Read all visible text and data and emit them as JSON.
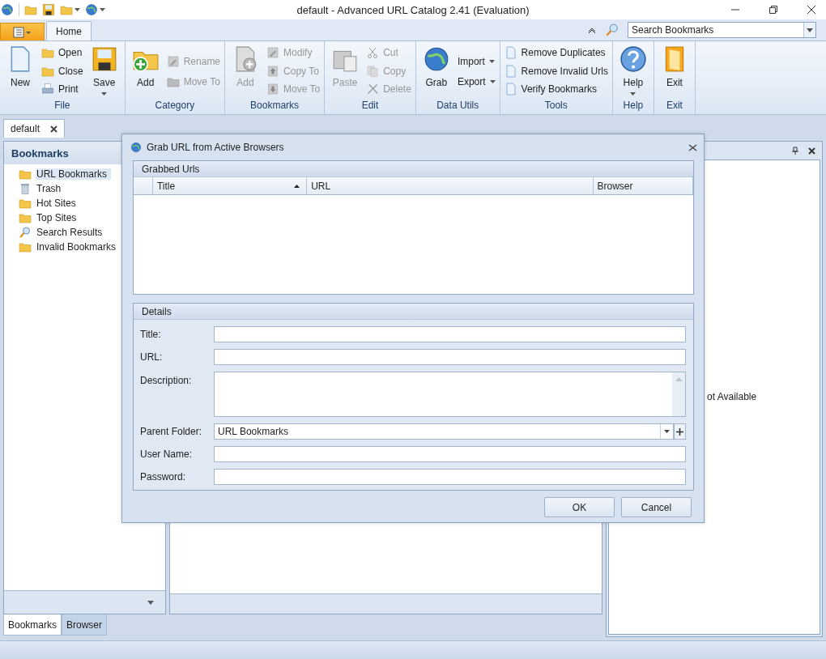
{
  "window": {
    "title": "default - Advanced URL Catalog 2.41 (Evaluation)"
  },
  "ribbon": {
    "tabs": [
      {
        "label": "Home",
        "selected": true
      }
    ],
    "search": {
      "value": "Search Bookmarks"
    },
    "groups": [
      {
        "label": "File",
        "items": [
          {
            "kind": "large",
            "label": "New",
            "disabled": false,
            "dropdown": false
          },
          {
            "kind": "small",
            "label": "Open",
            "disabled": false,
            "dropdown": false
          },
          {
            "kind": "small",
            "label": "Close",
            "disabled": false,
            "dropdown": false
          },
          {
            "kind": "small",
            "label": "Print",
            "disabled": false,
            "dropdown": false
          },
          {
            "kind": "large",
            "label": "Save",
            "disabled": false,
            "dropdown": true
          }
        ]
      },
      {
        "label": "Category",
        "items": [
          {
            "kind": "large",
            "label": "Add",
            "disabled": false,
            "dropdown": false
          },
          {
            "kind": "small",
            "label": "Rename",
            "disabled": true,
            "dropdown": false
          },
          {
            "kind": "small",
            "label": "Move To",
            "disabled": true,
            "dropdown": false
          }
        ]
      },
      {
        "label": "Bookmarks",
        "items": [
          {
            "kind": "large",
            "label": "Add",
            "disabled": true,
            "dropdown": false
          },
          {
            "kind": "small",
            "label": "Modify",
            "disabled": true,
            "dropdown": false
          },
          {
            "kind": "small",
            "label": "Copy To",
            "disabled": true,
            "dropdown": false
          },
          {
            "kind": "small",
            "label": "Move To",
            "disabled": true,
            "dropdown": false
          }
        ]
      },
      {
        "label": "Edit",
        "items": [
          {
            "kind": "large",
            "label": "Paste",
            "disabled": true,
            "dropdown": false
          },
          {
            "kind": "small",
            "label": "Cut",
            "disabled": true,
            "dropdown": false
          },
          {
            "kind": "small",
            "label": "Copy",
            "disabled": true,
            "dropdown": false
          },
          {
            "kind": "small",
            "label": "Delete",
            "disabled": true,
            "dropdown": false
          }
        ]
      },
      {
        "label": "Data Utils",
        "items": [
          {
            "kind": "large",
            "label": "Grab",
            "disabled": false,
            "dropdown": false
          },
          {
            "kind": "small",
            "label": "Import",
            "disabled": false,
            "dropdown": true
          },
          {
            "kind": "small",
            "label": "Export",
            "disabled": false,
            "dropdown": true
          }
        ]
      },
      {
        "label": "Tools",
        "items": [
          {
            "kind": "small",
            "label": "Remove Duplicates",
            "disabled": false,
            "dropdown": false
          },
          {
            "kind": "small",
            "label": "Remove Invalid Urls",
            "disabled": false,
            "dropdown": false
          },
          {
            "kind": "small",
            "label": "Verify Bookmarks",
            "disabled": false,
            "dropdown": false
          }
        ]
      },
      {
        "label": "Help",
        "items": [
          {
            "kind": "large",
            "label": "Help",
            "disabled": false,
            "dropdown": true
          }
        ]
      },
      {
        "label": "Exit",
        "items": [
          {
            "kind": "large",
            "label": "Exit",
            "disabled": false,
            "dropdown": false
          }
        ]
      }
    ]
  },
  "document_tabs": [
    {
      "label": "default"
    }
  ],
  "bookmarks_panel": {
    "title": "Bookmarks",
    "items": [
      {
        "label": "URL Bookmarks",
        "selected": true
      },
      {
        "label": "Trash",
        "selected": false
      },
      {
        "label": "Hot Sites",
        "selected": false
      },
      {
        "label": "Top Sites",
        "selected": false
      },
      {
        "label": "Search Results",
        "selected": false
      },
      {
        "label": "Invalid Bookmarks",
        "selected": false
      }
    ]
  },
  "bottom_tabs": [
    {
      "label": "Bookmarks",
      "selected": true
    },
    {
      "label": "Browser",
      "selected": false
    }
  ],
  "preview_panel": {
    "message": "ot Available"
  },
  "dialog": {
    "title": "Grab URL from Active Browsers",
    "grabbed": {
      "label": "Grabbed Urls",
      "columns": [
        {
          "label": "Title",
          "sorted": true
        },
        {
          "label": "URL",
          "sorted": false
        },
        {
          "label": "Browser",
          "sorted": false
        }
      ]
    },
    "details": {
      "label": "Details",
      "fields": [
        {
          "kind": "text",
          "label": "Title:"
        },
        {
          "kind": "text",
          "label": "URL:"
        },
        {
          "kind": "textarea",
          "label": "Description:"
        },
        {
          "kind": "combo",
          "label": "Parent Folder:",
          "value": "URL Bookmarks"
        },
        {
          "kind": "text",
          "label": "User Name:"
        },
        {
          "kind": "password",
          "label": "Password:"
        }
      ]
    },
    "buttons": [
      "OK",
      "Cancel"
    ]
  }
}
